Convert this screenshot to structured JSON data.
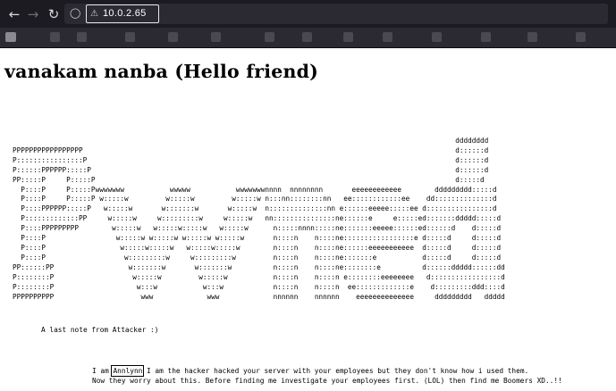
{
  "browser": {
    "back_icon": "arrow-left-icon",
    "forward_icon": "arrow-right-icon",
    "reload_icon": "reload-icon",
    "url": "10.0.2.65"
  },
  "page": {
    "heading": "vanakam nanba (Hello friend)",
    "ascii_art": "                                                                                                           dddddddd\nPPPPPPPPPPPPPPPPP                                                                                          d::::::d\nP::::::::::::::::P                                                                                         d::::::d\nP::::::PPPPPP:::::P                                                                                        d::::::d\nPP:::::P     P:::::P                                                                                       d:::::d\n  P::::P     P:::::Pwwwwwww           wwwww           wwwwwwwnnnn  nnnnnnnn       eeeeeeeeeeee        ddddddddd:::::d\n  P::::P     P:::::P w:::::w         w:::::w         w:::::w n:::nn::::::::nn   ee::::::::::::ee    dd::::::::::::::d\n  P::::PPPPPP:::::P   w:::::w       w:::::::w       w:::::w  n::::::::::::::nn e::::::eeeee:::::ee d::::::::::::::::d\n  P:::::::::::::PP     w:::::w     w:::::::::w     w:::::w   nn:::::::::::::::ne::::::e     e:::::ed:::::::ddddd:::::d\n  P::::PPPPPPPPP        w:::::w   w:::::w:::::w   w:::::w      n:::::nnnn:::::ne:::::::eeeee::::::ed::::::d    d:::::d\n  P::::P                 w:::::w w:::::w w:::::w w:::::w       n::::n    n::::ne:::::::::::::::::e d:::::d     d:::::d\n  P::::P                  w:::::w:::::w   w:::::w:::::w        n::::n    n::::ne::::::eeeeeeeeeee  d:::::d     d:::::d\n  P::::P                   w:::::::::w     w:::::::::w         n::::n    n::::ne:::::::e           d:::::d     d:::::d\nPP::::::PP                  w:::::::w       w:::::::w          n::::n    n::::ne::::::::e          d::::::ddddd::::::dd\nP::::::::P                   w:::::w         w:::::w           n::::n    n::::n e::::::::eeeeeeee   d:::::::::::::::::d\nP::::::::P                    w:::w           w:::w            n::::n    n::::n  ee:::::::::::::e    d:::::::::ddd::::d\nPPPPPPPPPP                     www             www             nnnnnn    nnnnnn    eeeeeeeeeeeeee     ddddddddd   ddddd",
    "note_title": "A last note from Attacker :)",
    "message": {
      "prefix": "I am ",
      "name": "Annlynn",
      "line1_rest": " I am the hacker hacked your server with your employees but they don't know how i used them.",
      "line2": "Now they worry about this. Before finding me investigate your employees first. (LOL) then find me Boomers XD..!!"
    }
  }
}
